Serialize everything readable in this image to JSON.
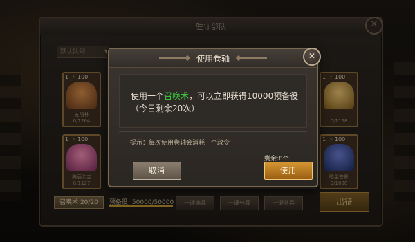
{
  "background": {
    "garrison_title": "驻守部队",
    "team_select": "默认队列",
    "heroes": [
      {
        "level": "1",
        "power": "100",
        "name": "五阳林",
        "count": "0/1264",
        "color": "#9a5a2a"
      },
      {
        "level": "1",
        "power": "100",
        "name": "美丽公主",
        "count": "0/1127",
        "color": "#b8508a"
      },
      {
        "level": "1",
        "power": "100",
        "name": "",
        "count": "0/1168",
        "color": "#c89a3a"
      },
      {
        "level": "1",
        "power": "100",
        "name": "暗星苍影",
        "count": "0/1088",
        "color": "#3a4a9a"
      }
    ],
    "summon_button": "召唤术  20/20",
    "reserve_label": "预备役: 50000/50000",
    "reserve_fill": 1.0,
    "buttons": [
      "一键满兵",
      "一键分兵",
      "一键补兵"
    ],
    "deploy_button": "出征"
  },
  "modal": {
    "title": "使用卷轴",
    "message_prefix": "使用一个",
    "message_item": "召唤术",
    "message_suffix": "，可以立即获得10000预备役（今日剩余20次）",
    "hint": "提示：每次使用卷轴会消耗一个政令",
    "remaining": "剩余:8个",
    "cancel_label": "取消",
    "use_label": "使用"
  },
  "colors": {
    "highlight": "#3ecf3e",
    "use_button": "#d49532",
    "cancel_button": "#8a7d6e"
  },
  "icons": {
    "close": "close-icon",
    "power": "lightning-icon"
  }
}
